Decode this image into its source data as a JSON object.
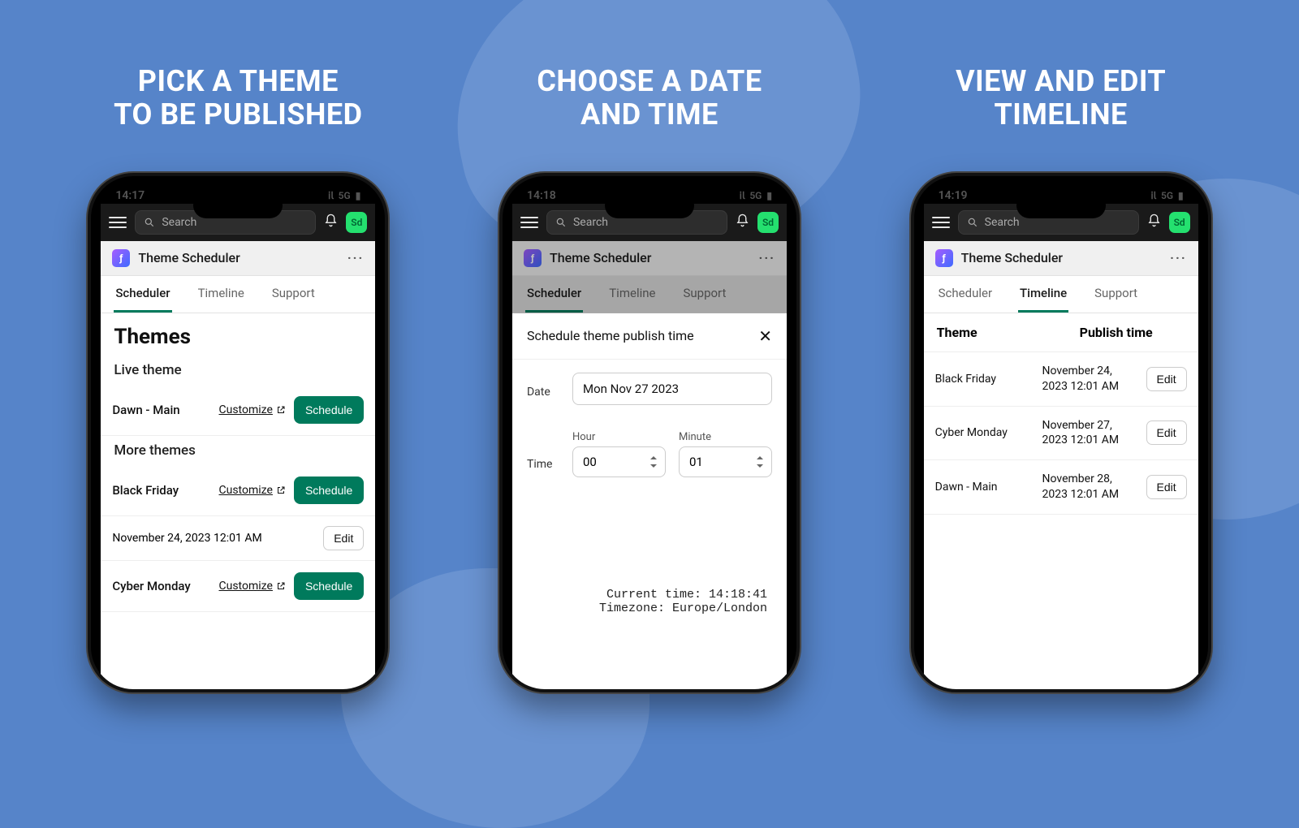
{
  "avatar": "Sd",
  "app_title": "Theme Scheduler",
  "search_placeholder": "Search",
  "tabs": {
    "scheduler": "Scheduler",
    "timeline": "Timeline",
    "support": "Support"
  },
  "headings": {
    "p1a": "PICK A THEME",
    "p1b": "TO BE PUBLISHED",
    "p2a": "CHOOSE A DATE",
    "p2b": "AND TIME",
    "p3a": "VIEW AND EDIT",
    "p3b": "TIMELINE"
  },
  "status": {
    "t1": "14:17",
    "t2": "14:18",
    "t3": "14:19",
    "net": "5G"
  },
  "panel1": {
    "title": "Themes",
    "live_label": "Live theme",
    "more_label": "More themes",
    "customize": "Customize",
    "schedule": "Schedule",
    "edit": "Edit",
    "live": {
      "name": "Dawn - Main"
    },
    "rows": [
      {
        "name": "Black Friday",
        "date": "November 24, 2023 12:01 AM"
      },
      {
        "name": "Cyber Monday"
      }
    ]
  },
  "panel2": {
    "modal_title": "Schedule theme publish time",
    "date_label": "Date",
    "date_value": "Mon Nov 27 2023",
    "time_label": "Time",
    "hour_label": "Hour",
    "hour_value": "00",
    "minute_label": "Minute",
    "minute_value": "01",
    "current_line": "Current time: 14:18:41",
    "tz_line": "Timezone: Europe/London"
  },
  "panel3": {
    "col_theme": "Theme",
    "col_time": "Publish time",
    "edit": "Edit",
    "rows": [
      {
        "name": "Black Friday",
        "time": "November 24, 2023 12:01 AM"
      },
      {
        "name": "Cyber Monday",
        "time": "November 27, 2023 12:01 AM"
      },
      {
        "name": "Dawn - Main",
        "time": "November 28, 2023 12:01 AM"
      }
    ]
  }
}
